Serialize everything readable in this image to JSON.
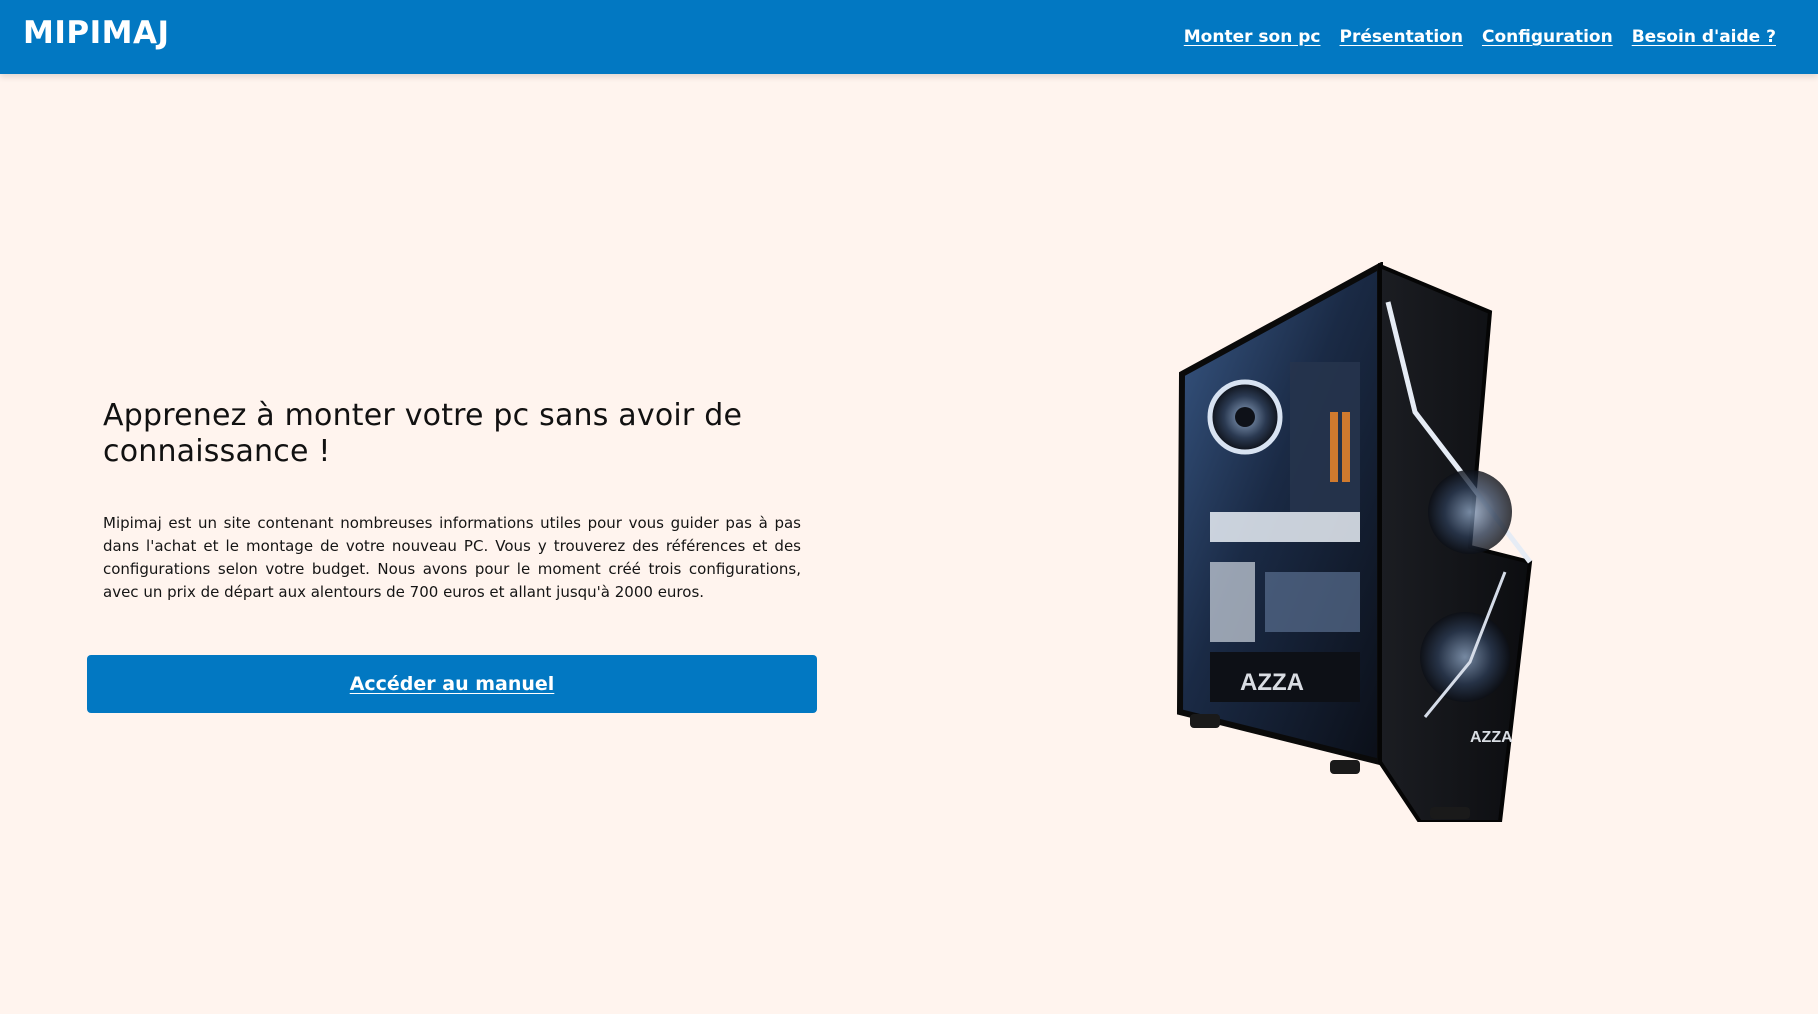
{
  "header": {
    "brand": "MIPIMAJ",
    "nav": [
      {
        "label": "Monter son pc"
      },
      {
        "label": "Présentation"
      },
      {
        "label": "Configuration"
      },
      {
        "label": "Besoin d'aide ?"
      }
    ],
    "background_color": "#0278c2"
  },
  "hero": {
    "title": "Apprenez à monter votre pc sans avoir de connaissance !",
    "description": "Mipimaj est un site contenant nombreuses informations utiles pour vous guider pas à pas dans l'achat et le montage de votre nouveau PC. Vous y trouverez des références et des configurations selon votre budget. Nous avons pour le moment créé trois configurations, avec un prix de départ aux alentours de 700 euros et allant jusqu'à 2000 euros.",
    "cta_label": "Accéder au manuel",
    "image": {
      "icon": "pc-tower-case-image",
      "case_logo_text": "AZZA"
    }
  },
  "colors": {
    "page_background": "#fff4ee",
    "accent": "#0278c2"
  }
}
